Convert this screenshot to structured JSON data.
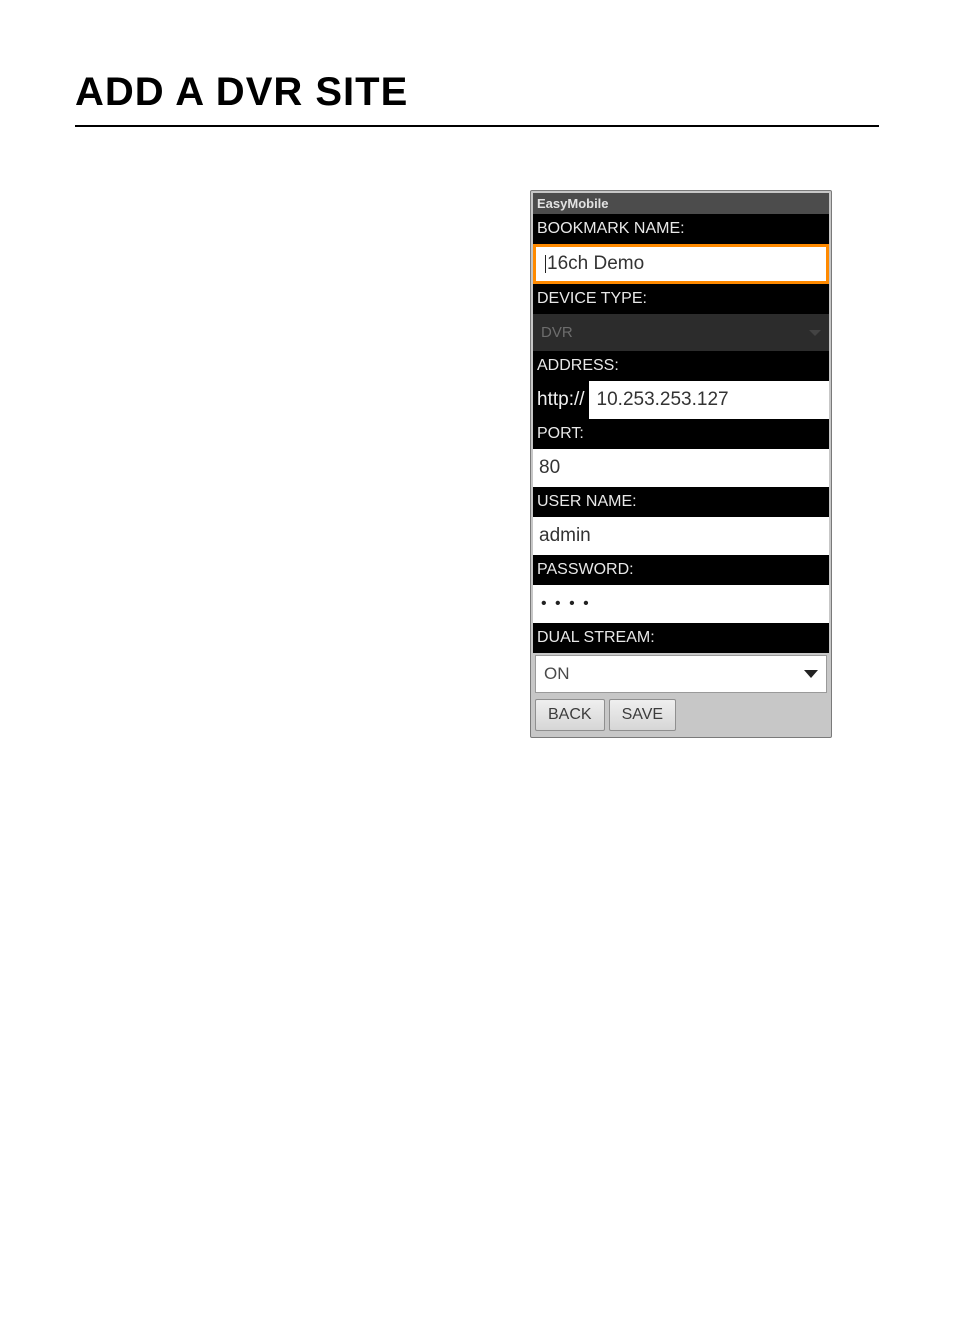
{
  "document": {
    "heading": "ADD A DVR SITE"
  },
  "app": {
    "title": "EasyMobile"
  },
  "form": {
    "bookmark_label": "BOOKMARK NAME:",
    "bookmark_value": "16ch Demo",
    "device_type_label": "DEVICE TYPE:",
    "device_type_value": "DVR",
    "address_label": "ADDRESS:",
    "address_prefix": "http://",
    "address_value": "10.253.253.127",
    "port_label": "PORT:",
    "port_value": "80",
    "username_label": "USER NAME:",
    "username_value": "admin",
    "password_label": "PASSWORD:",
    "password_value_masked": "• • • •",
    "password_dot_count": 4,
    "dualstream_label": "DUAL STREAM:",
    "dualstream_value": "ON"
  },
  "buttons": {
    "back": "BACK",
    "save": "SAVE"
  }
}
